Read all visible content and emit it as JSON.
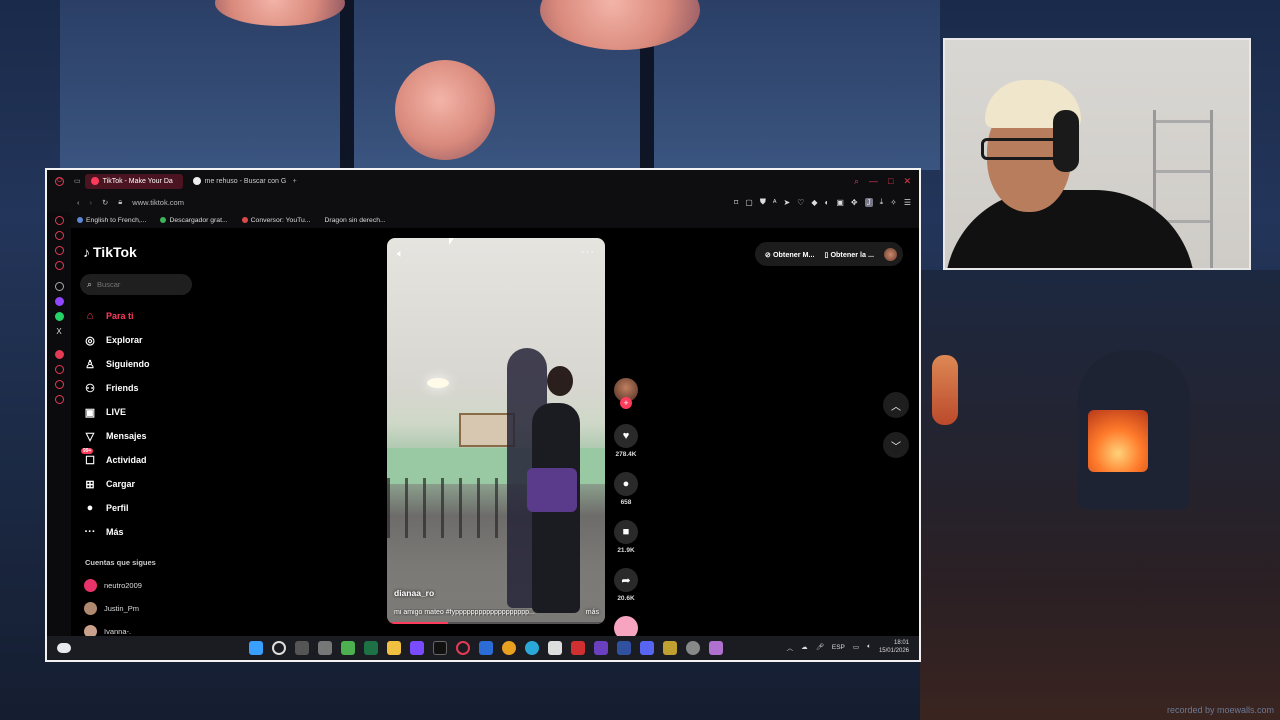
{
  "browser": {
    "tabs": [
      {
        "label": "TikTok - Make Your Da",
        "active": true
      },
      {
        "label": "me rehuso - Buscar con G",
        "active": false
      }
    ],
    "url": "www.tiktok.com",
    "bookmarks": [
      "English to French,...",
      "Descargador grat...",
      "Conversor: YouTu...",
      "Dragon sin derech..."
    ]
  },
  "tiktok": {
    "logo": "TikTok",
    "search_placeholder": "Buscar",
    "nav": [
      {
        "label": "Para ti",
        "icon": "home-icon",
        "glyph": "⌂",
        "active": true
      },
      {
        "label": "Explorar",
        "icon": "compass-icon",
        "glyph": "◎",
        "active": false
      },
      {
        "label": "Siguiendo",
        "icon": "user-follow-icon",
        "glyph": "♙",
        "active": false
      },
      {
        "label": "Friends",
        "icon": "friends-icon",
        "glyph": "⚇",
        "active": false
      },
      {
        "label": "LIVE",
        "icon": "live-icon",
        "glyph": "▣",
        "active": false
      },
      {
        "label": "Mensajes",
        "icon": "messages-icon",
        "glyph": "▽",
        "active": false
      },
      {
        "label": "Actividad",
        "icon": "activity-icon",
        "glyph": "☐",
        "active": false,
        "badge": "99+"
      },
      {
        "label": "Cargar",
        "icon": "upload-icon",
        "glyph": "⊞",
        "active": false
      },
      {
        "label": "Perfil",
        "icon": "profile-icon",
        "glyph": "●",
        "active": false
      },
      {
        "label": "Más",
        "icon": "more-icon",
        "glyph": "···",
        "active": false
      }
    ],
    "following_title": "Cuentas que sigues",
    "following": [
      {
        "name": "neutro2009",
        "color": "#e8336a"
      },
      {
        "name": "Justin_Pm",
        "color": "#b08a70"
      },
      {
        "name": "Ivanna-.",
        "color": "#c9a08a"
      }
    ],
    "top_buttons": [
      "Obtener M...",
      "Obtener la ..."
    ],
    "video": {
      "username": "dianaa_ro",
      "caption": "mi amigo mateo #fyppppppppppppppppppp...",
      "more": "más",
      "progress": 0.28
    },
    "actions": [
      {
        "icon": "heart-icon",
        "glyph": "♥",
        "count": "278.4K"
      },
      {
        "icon": "comment-icon",
        "glyph": "●",
        "count": "658"
      },
      {
        "icon": "bookmark-icon",
        "glyph": "■",
        "count": "21.9K"
      },
      {
        "icon": "share-icon",
        "glyph": "➦",
        "count": "20.6K"
      }
    ]
  },
  "taskbar": {
    "language": "ESP",
    "time": "18:01",
    "date": "15/01/2026"
  },
  "watermark": "recorded by moewalls.com",
  "colors": {
    "accent": "#ff3b5c",
    "opera_red": "#e33b55"
  }
}
